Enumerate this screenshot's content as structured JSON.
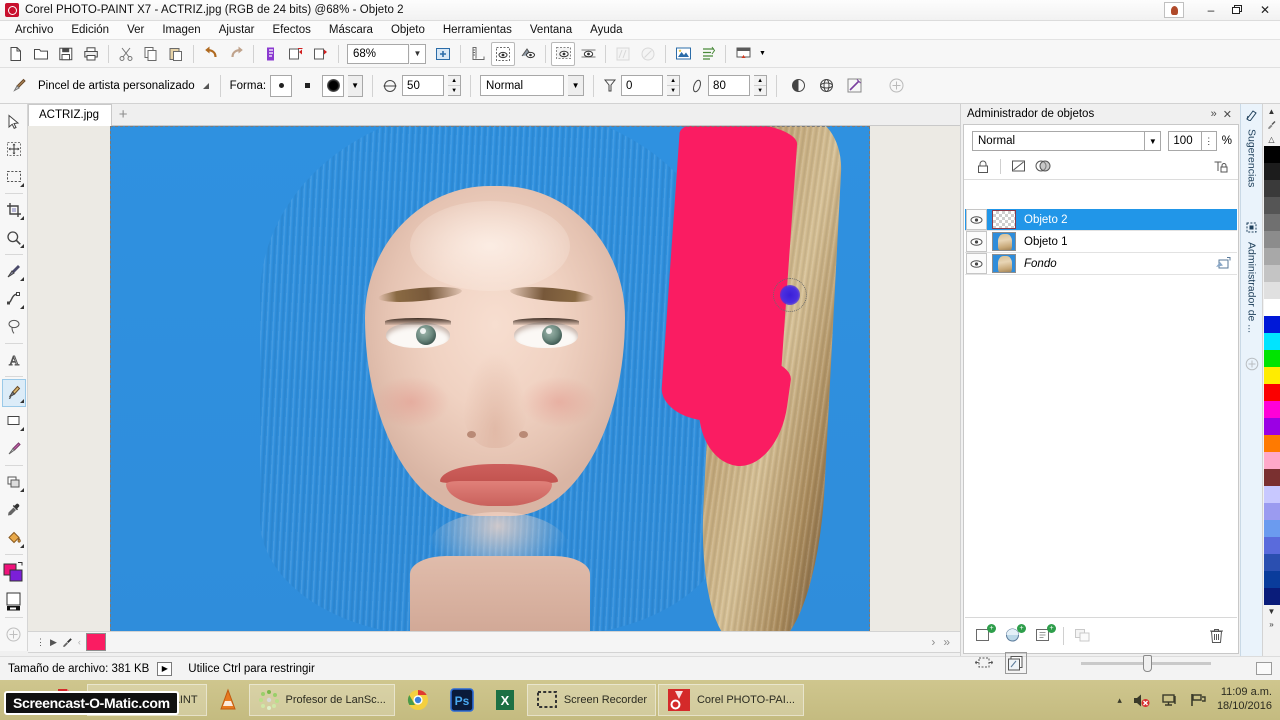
{
  "window": {
    "title": "Corel PHOTO-PAINT X7 - ACTRIZ.jpg (RGB de 24 bits) @68% - Objeto 2",
    "app_icon": "corel-photopaint-icon",
    "minimize": "–",
    "maximize": "❐",
    "close": "✕",
    "user_icon": "user-account-icon"
  },
  "menu": {
    "items": [
      {
        "label": "Archivo"
      },
      {
        "label": "Edición"
      },
      {
        "label": "Ver"
      },
      {
        "label": "Imagen"
      },
      {
        "label": "Ajustar"
      },
      {
        "label": "Efectos"
      },
      {
        "label": "Máscara"
      },
      {
        "label": "Objeto"
      },
      {
        "label": "Herramientas"
      },
      {
        "label": "Ventana"
      },
      {
        "label": "Ayuda"
      }
    ]
  },
  "standard_toolbar": {
    "zoom_value": "68%",
    "buttons": [
      {
        "name": "new-icon"
      },
      {
        "name": "open-icon"
      },
      {
        "name": "save-icon"
      },
      {
        "name": "print-icon"
      },
      {
        "name": "cut-icon"
      },
      {
        "name": "copy-icon"
      },
      {
        "name": "paste-icon"
      },
      {
        "name": "undo-icon"
      },
      {
        "name": "redo-icon"
      },
      {
        "name": "import-icon"
      },
      {
        "name": "export-icon"
      },
      {
        "name": "publish-pdf-icon"
      },
      {
        "name": "zoom-level-dropdown"
      },
      {
        "name": "fullscreen-preview-icon"
      },
      {
        "name": "rulers-icon"
      },
      {
        "name": "grid-icon"
      },
      {
        "name": "guidelines-icon"
      },
      {
        "name": "snap-icon"
      },
      {
        "name": "mask-overlay-icon"
      },
      {
        "name": "mask-marquee-icon"
      },
      {
        "name": "clear-mask-icon"
      },
      {
        "name": "remove-mask-icon"
      },
      {
        "name": "image-adjustment-lab-icon"
      },
      {
        "name": "correction-icon"
      },
      {
        "name": "application-launcher-icon"
      }
    ]
  },
  "property_bar": {
    "tool_name": "Pincel de artista personalizado",
    "tool_icon": "paintbrush-icon",
    "shape_label": "Forma:",
    "size_label_icon": "brush-size-icon",
    "size_value": "50",
    "merge_mode": "Normal",
    "transparency_icon": "transparency-icon",
    "transparency_value": "0",
    "feather_icon": "feather-icon",
    "feather_value": "80",
    "extra_buttons": [
      {
        "name": "nib-properties-icon"
      },
      {
        "name": "stroke-attributes-icon"
      },
      {
        "name": "dab-attributes-icon"
      },
      {
        "name": "add-more-icon"
      }
    ]
  },
  "toolbox": {
    "tools": [
      {
        "name": "pick-tool",
        "icon": "cursor-arrow-icon",
        "active": false
      },
      {
        "name": "object-pick-tool",
        "icon": "move-crosshair-icon",
        "active": false
      },
      {
        "name": "mask-rectangle-tool",
        "icon": "rect-marquee-icon",
        "active": false
      },
      {
        "name": "crop-tool",
        "icon": "crop-icon",
        "active": false
      },
      {
        "name": "zoom-tool",
        "icon": "magnifier-icon",
        "active": false
      },
      {
        "name": "brush-transform-tool",
        "icon": "mask-transform-icon",
        "active": false
      },
      {
        "name": "shape-edit-tool",
        "icon": "path-node-icon",
        "active": false
      },
      {
        "name": "freehand-mask-tool",
        "icon": "lasso-icon",
        "active": false
      },
      {
        "name": "text-tool",
        "icon": "text-a-icon",
        "active": false
      },
      {
        "name": "paint-tool",
        "icon": "paintbrush-tool-icon",
        "active": true
      },
      {
        "name": "rectangle-tool",
        "icon": "rectangle-shape-icon",
        "active": false
      },
      {
        "name": "effect-tool",
        "icon": "effect-brush-icon",
        "active": false
      },
      {
        "name": "clone-tool",
        "icon": "clone-stamp-icon",
        "active": false
      },
      {
        "name": "eyedropper-tool",
        "icon": "eyedropper-icon",
        "active": false
      },
      {
        "name": "fill-tool",
        "icon": "paint-bucket-icon",
        "active": false
      },
      {
        "name": "color-swatches",
        "icon": "fg-bg-color-icon",
        "active": false
      },
      {
        "name": "paper-color",
        "icon": "paper-color-icon",
        "active": false
      },
      {
        "name": "add-tool",
        "icon": "plus-circle-icon",
        "active": false
      }
    ]
  },
  "document": {
    "tab_label": "ACTRIZ.jpg",
    "new_tab_label": "+",
    "canvas": {
      "background_color": "#2f8ddb",
      "paint_stroke_color": "#fa1c62",
      "brush_cursor_color": "#4a2fe0",
      "subject": "portrait-photo"
    }
  },
  "canvas_nav": {
    "swatch_color": "#fa1c62",
    "prev_icon": "▶",
    "eyedropper_icon": "eyedropper-small-icon",
    "next_icon": "›",
    "end_icon": "»"
  },
  "status_bar": {
    "file_size_label": "Tamaño de archivo: 381 KB",
    "play_icon": "▶",
    "hint": "Utilice Ctrl para restringir",
    "right_icon": "color-proof-icon"
  },
  "docker": {
    "title": "Administrador de objetos",
    "collapse_icon": "»",
    "close_icon": "✕",
    "blend_mode": "Normal",
    "opacity_value": "100",
    "opacity_unit": "%",
    "lock_buttons": [
      {
        "name": "lock-transparency-icon"
      },
      {
        "name": "edit-mask-icon"
      },
      {
        "name": "mask-overlay-toggle-icon"
      },
      {
        "name": "lock-all-icon"
      }
    ],
    "layers": [
      {
        "name": "Objeto 2",
        "selected": true,
        "thumb": "transparent",
        "italic": false,
        "visible": true
      },
      {
        "name": "Objeto 1",
        "selected": false,
        "thumb": "photo",
        "italic": false,
        "visible": true
      },
      {
        "name": "Fondo",
        "selected": false,
        "thumb": "photo",
        "italic": true,
        "visible": true,
        "extra_icon": "background-duplicate-icon"
      }
    ],
    "footer_buttons": [
      {
        "name": "new-object-button"
      },
      {
        "name": "new-lens-button"
      },
      {
        "name": "new-object-from-selection-button"
      },
      {
        "name": "combine-objects-button"
      },
      {
        "name": "delete-object-button"
      }
    ],
    "footer2_buttons": [
      {
        "name": "object-transparency-button"
      },
      {
        "name": "object-clip-mask-button"
      }
    ]
  },
  "side_tabs": [
    {
      "label": "Sugerencias",
      "icon": "hints-icon"
    },
    {
      "label": "Administrador de ...",
      "icon": "object-manager-icon"
    },
    {
      "label": "",
      "icon": "plus-circle-icon"
    }
  ],
  "palette": {
    "top_icons": [
      "▶",
      "eyedropper-icon",
      "∧"
    ],
    "colors": [
      "#000000",
      "#1c1c1c",
      "#3a3a3a",
      "#555555",
      "#707070",
      "#8c8c8c",
      "#a8a8a8",
      "#c4c4c4",
      "#e0e0e0",
      "#ffffff",
      "#0018d8",
      "#00e4ff",
      "#00e400",
      "#ffec00",
      "#fb0000",
      "#ff00d8",
      "#9b00e4",
      "#ff7a00",
      "#ffa8c8",
      "#7a3030",
      "#c8c8ff",
      "#9b9bf0",
      "#6b9bef",
      "#5a6bdc",
      "#2b4fb0",
      "#0a3c9b",
      "#0a1c7a"
    ],
    "bottom_icons": [
      "∨",
      "»"
    ]
  },
  "taskbar": {
    "items": [
      {
        "name": "ie-icon",
        "label": ""
      },
      {
        "name": "pdf-icon",
        "label": ""
      },
      {
        "name": "photo-paint-folder",
        "label": "PHOTO PAINT"
      },
      {
        "name": "vlc-icon",
        "label": ""
      },
      {
        "name": "lanschool-icon",
        "label": "Profesor de LanSc..."
      },
      {
        "name": "chrome-icon",
        "label": ""
      },
      {
        "name": "photoshop-icon",
        "label": "Ps"
      },
      {
        "name": "excel-icon",
        "label": "X"
      },
      {
        "name": "screen-recorder-icon",
        "label": "Screen Recorder"
      },
      {
        "name": "corel-photopaint-icon",
        "label": "Corel PHOTO-PAI..."
      }
    ],
    "tray_icons": [
      "▴",
      "volume-muted-icon",
      "network-icon",
      "flag-icon"
    ],
    "clock_time": "11:09 a.m.",
    "clock_date": "18/10/2016"
  },
  "watermark": {
    "text": "Screencast-O-Matic.com"
  }
}
